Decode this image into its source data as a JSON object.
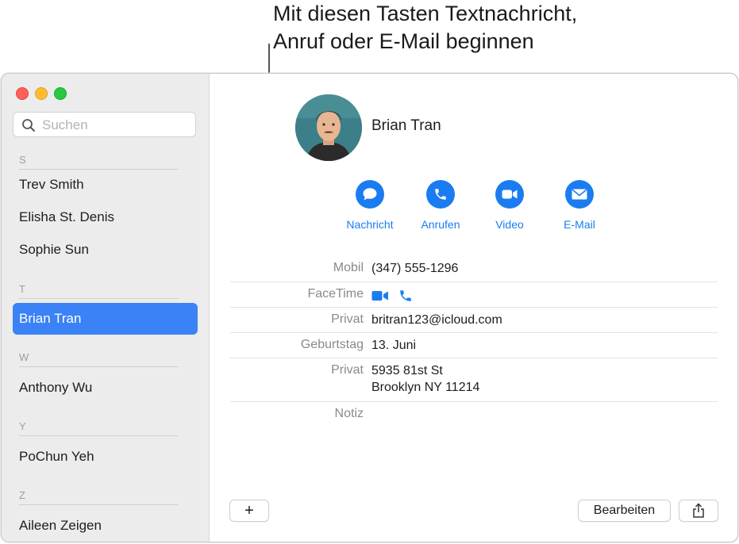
{
  "callout": {
    "line1": "Mit diesen Tasten Textnachricht,",
    "line2": "Anruf oder E-Mail beginnen"
  },
  "colors": {
    "accent": "#1a7cf0",
    "selection": "#3b82f6",
    "close": "#fe5f57",
    "minimize": "#febc2e",
    "zoom": "#28c840"
  },
  "sidebar": {
    "search_placeholder": "Suchen",
    "sections": [
      {
        "letter": "S",
        "contacts": [
          "Trev Smith",
          "Elisha St. Denis",
          "Sophie Sun"
        ]
      },
      {
        "letter": "T",
        "contacts": [
          "Brian Tran"
        ]
      },
      {
        "letter": "W",
        "contacts": [
          "Anthony Wu"
        ]
      },
      {
        "letter": "Y",
        "contacts": [
          "PoChun Yeh"
        ]
      },
      {
        "letter": "Z",
        "contacts": [
          "Aileen Zeigen"
        ]
      }
    ],
    "selected": "Brian Tran"
  },
  "detail": {
    "name": "Brian Tran",
    "actions": [
      {
        "label": "Nachricht",
        "icon": "message-icon"
      },
      {
        "label": "Anrufen",
        "icon": "phone-icon"
      },
      {
        "label": "Video",
        "icon": "video-icon"
      },
      {
        "label": "E-Mail",
        "icon": "mail-icon"
      }
    ],
    "fields": {
      "mobile_label": "Mobil",
      "mobile_value": "(347) 555-1296",
      "facetime_label": "FaceTime",
      "email_label": "Privat",
      "email_value": "britran123@icloud.com",
      "birthday_label": "Geburtstag",
      "birthday_value": "13. Juni",
      "address_label": "Privat",
      "address_line1": "5935 81st St",
      "address_line2": "Brooklyn NY 11214",
      "note_label": "Notiz"
    },
    "buttons": {
      "add": "+",
      "edit": "Bearbeiten",
      "share_icon": "share-icon"
    }
  }
}
